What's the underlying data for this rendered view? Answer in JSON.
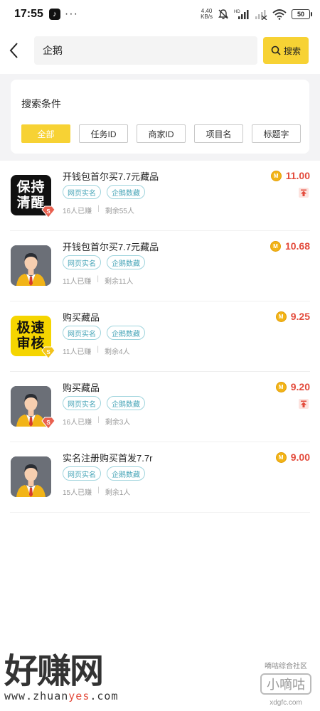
{
  "status_bar": {
    "time": "17:55",
    "app_icon": "tiktok-icon",
    "more": "···",
    "net_speed_value": "4.40",
    "net_speed_unit": "KB/s",
    "battery": "50"
  },
  "header": {
    "search_value": "企鹅",
    "search_button_label": "搜索"
  },
  "filter": {
    "title": "搜索条件",
    "chips": [
      {
        "label": "全部",
        "active": true
      },
      {
        "label": "任务ID",
        "active": false
      },
      {
        "label": "商家ID",
        "active": false
      },
      {
        "label": "项目名",
        "active": false
      },
      {
        "label": "标题字",
        "active": false
      }
    ]
  },
  "tasks": [
    {
      "title": "开钱包首尔买7.7元藏品",
      "thumb_text": [
        "保持",
        "清醒"
      ],
      "thumb_style": "black",
      "tags": [
        "网页实名",
        "企鹅数藏"
      ],
      "earned": "16人已赚",
      "remaining": "剩余55人",
      "price": "11.00",
      "pinned": true
    },
    {
      "title": "开钱包首尔买7.7元藏品",
      "thumb_text": [],
      "thumb_style": "avatar",
      "tags": [
        "网页实名",
        "企鹅数藏"
      ],
      "earned": "11人已赚",
      "remaining": "剩余11人",
      "price": "10.68",
      "pinned": false
    },
    {
      "title": "购买藏品",
      "thumb_text": [
        "极速",
        "审核"
      ],
      "thumb_style": "yellow",
      "tags": [
        "网页实名",
        "企鹅数藏"
      ],
      "earned": "11人已赚",
      "remaining": "剩余4人",
      "price": "9.25",
      "pinned": false
    },
    {
      "title": "购买藏品",
      "thumb_text": [],
      "thumb_style": "avatar",
      "tags": [
        "网页实名",
        "企鹅数藏"
      ],
      "earned": "16人已赚",
      "remaining": "剩余3人",
      "price": "9.20",
      "pinned": true
    },
    {
      "title": "实名注册购买首发7.7r",
      "thumb_text": [],
      "thumb_style": "avatar",
      "tags": [
        "网页实名",
        "企鹅数藏"
      ],
      "earned": "15人已赚",
      "remaining": "剩余1人",
      "price": "9.00",
      "pinned": false
    }
  ],
  "coin_label": "M",
  "watermark": {
    "main": "好赚网",
    "url_prefix": "www.zhuan",
    "url_mid": "yes",
    "url_suffix": ".com",
    "right_top": "嘀咕综合社区",
    "right_box": "小嘀咕",
    "right_url": "xdgfc.com"
  },
  "colors": {
    "accent": "#f7d234",
    "price": "#e34b3c",
    "tag": "#49a6b8"
  }
}
